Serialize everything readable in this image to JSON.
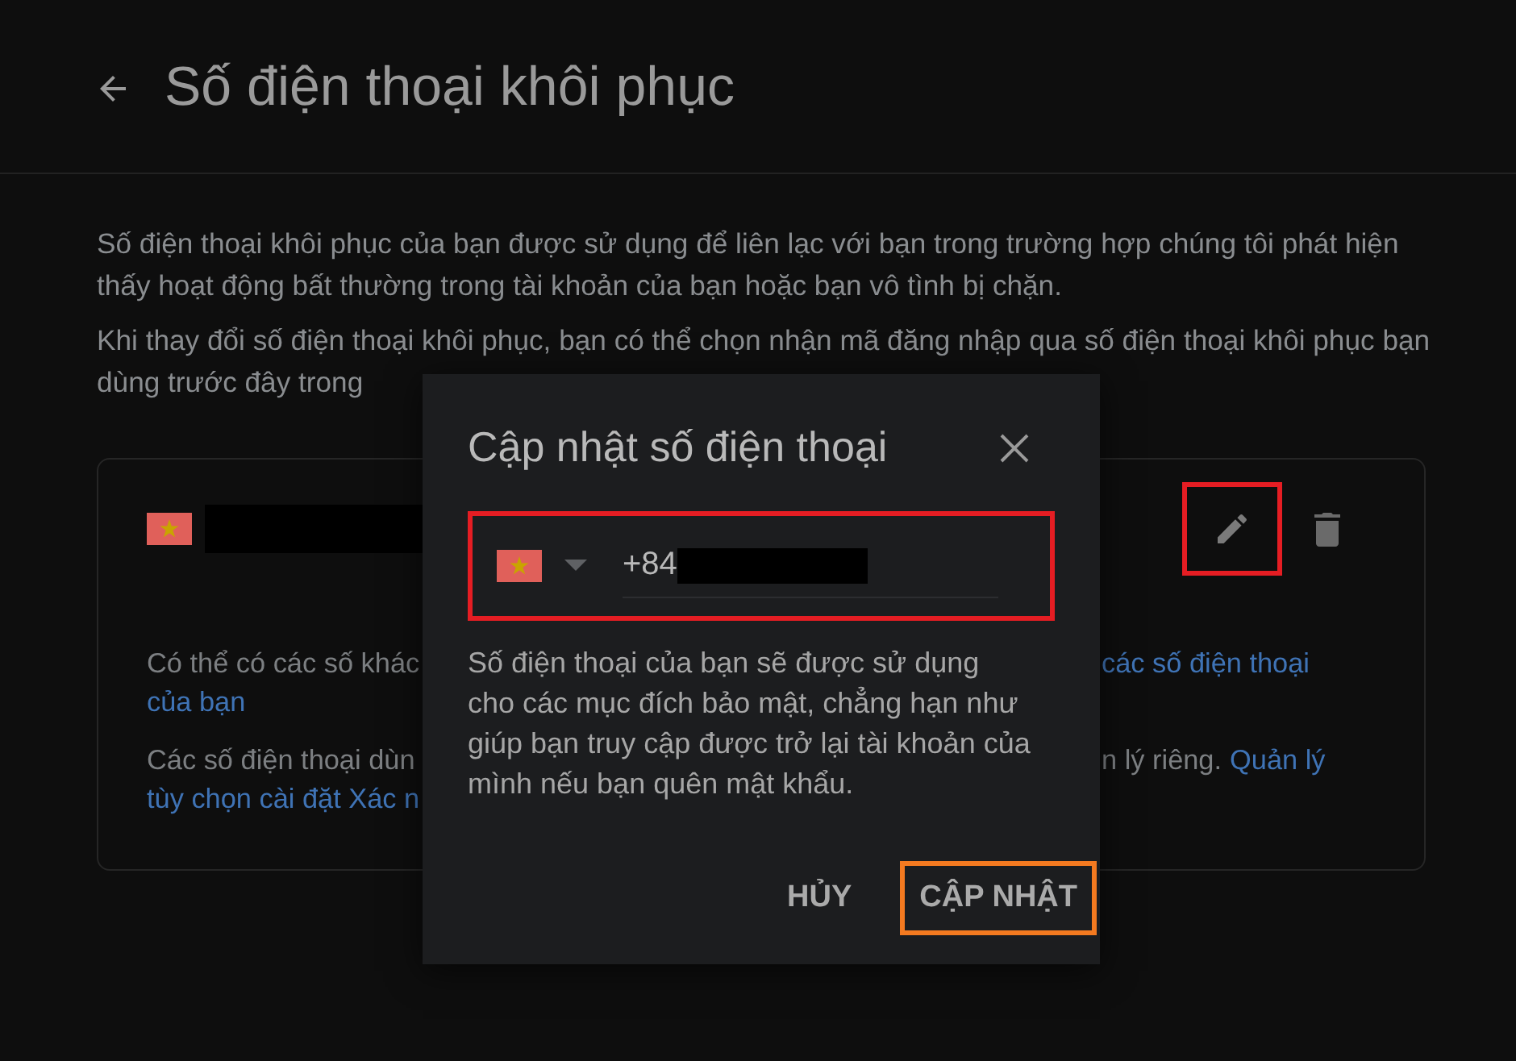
{
  "header": {
    "title": "Số điện thoại khôi phục"
  },
  "intro": [
    "Số điện thoại khôi phục của bạn được sử dụng để liên lạc với bạn trong trường hợp chúng tôi phát hiện thấy hoạt động bất thường trong tài khoản của bạn hoặc bạn vô tình bị chặn.",
    "Khi thay đổi số điện thoại khôi phục, bạn có thể chọn nhận mã đăng nhập qua số điện thoại khôi phục bạn dùng trước đây trong"
  ],
  "card": {
    "edit_highlighted": true,
    "rows": [
      {
        "left": [
          {
            "text": "Có thể có các số khác",
            "kind": "text"
          }
        ],
        "right": [
          {
            "text": "các số điện thoại",
            "kind": "link"
          }
        ]
      },
      {
        "left": [
          {
            "text": "của bạn",
            "kind": "link"
          }
        ]
      },
      {
        "left": [
          {
            "text": "Các số điện thoại dùn",
            "kind": "text"
          }
        ],
        "right": [
          {
            "text": "n lý riêng.",
            "kind": "text"
          },
          {
            "text": "Quản lý",
            "kind": "link"
          }
        ]
      },
      {
        "left": [
          {
            "text": "tùy chọn cài đặt Xác n",
            "kind": "link"
          }
        ]
      }
    ]
  },
  "dialog": {
    "title": "Cập nhật số điện thoại",
    "field": {
      "value": "+84",
      "highlighted": true
    },
    "description": "Số điện thoại của bạn sẽ được sử dụng cho các mục đích bảo mật, chẳng hạn như giúp bạn truy cập được trở lại tài khoản của mình nếu bạn quên mật khẩu.",
    "buttons": [
      {
        "label": "HỦY",
        "highlighted": false
      },
      {
        "label": "CẬP NHẬT",
        "highlighted": true
      }
    ]
  }
}
